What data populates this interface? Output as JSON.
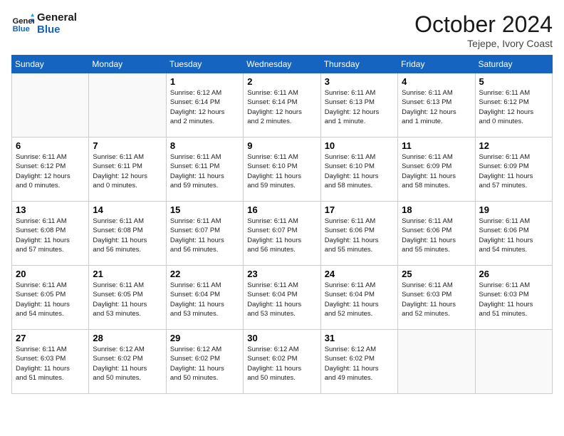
{
  "logo": {
    "line1": "General",
    "line2": "Blue"
  },
  "title": "October 2024",
  "subtitle": "Tejepe, Ivory Coast",
  "days_of_week": [
    "Sunday",
    "Monday",
    "Tuesday",
    "Wednesday",
    "Thursday",
    "Friday",
    "Saturday"
  ],
  "weeks": [
    [
      {
        "day": "",
        "info": ""
      },
      {
        "day": "",
        "info": ""
      },
      {
        "day": "1",
        "info": "Sunrise: 6:12 AM\nSunset: 6:14 PM\nDaylight: 12 hours\nand 2 minutes."
      },
      {
        "day": "2",
        "info": "Sunrise: 6:11 AM\nSunset: 6:14 PM\nDaylight: 12 hours\nand 2 minutes."
      },
      {
        "day": "3",
        "info": "Sunrise: 6:11 AM\nSunset: 6:13 PM\nDaylight: 12 hours\nand 1 minute."
      },
      {
        "day": "4",
        "info": "Sunrise: 6:11 AM\nSunset: 6:13 PM\nDaylight: 12 hours\nand 1 minute."
      },
      {
        "day": "5",
        "info": "Sunrise: 6:11 AM\nSunset: 6:12 PM\nDaylight: 12 hours\nand 0 minutes."
      }
    ],
    [
      {
        "day": "6",
        "info": "Sunrise: 6:11 AM\nSunset: 6:12 PM\nDaylight: 12 hours\nand 0 minutes."
      },
      {
        "day": "7",
        "info": "Sunrise: 6:11 AM\nSunset: 6:11 PM\nDaylight: 12 hours\nand 0 minutes."
      },
      {
        "day": "8",
        "info": "Sunrise: 6:11 AM\nSunset: 6:11 PM\nDaylight: 11 hours\nand 59 minutes."
      },
      {
        "day": "9",
        "info": "Sunrise: 6:11 AM\nSunset: 6:10 PM\nDaylight: 11 hours\nand 59 minutes."
      },
      {
        "day": "10",
        "info": "Sunrise: 6:11 AM\nSunset: 6:10 PM\nDaylight: 11 hours\nand 58 minutes."
      },
      {
        "day": "11",
        "info": "Sunrise: 6:11 AM\nSunset: 6:09 PM\nDaylight: 11 hours\nand 58 minutes."
      },
      {
        "day": "12",
        "info": "Sunrise: 6:11 AM\nSunset: 6:09 PM\nDaylight: 11 hours\nand 57 minutes."
      }
    ],
    [
      {
        "day": "13",
        "info": "Sunrise: 6:11 AM\nSunset: 6:08 PM\nDaylight: 11 hours\nand 57 minutes."
      },
      {
        "day": "14",
        "info": "Sunrise: 6:11 AM\nSunset: 6:08 PM\nDaylight: 11 hours\nand 56 minutes."
      },
      {
        "day": "15",
        "info": "Sunrise: 6:11 AM\nSunset: 6:07 PM\nDaylight: 11 hours\nand 56 minutes."
      },
      {
        "day": "16",
        "info": "Sunrise: 6:11 AM\nSunset: 6:07 PM\nDaylight: 11 hours\nand 56 minutes."
      },
      {
        "day": "17",
        "info": "Sunrise: 6:11 AM\nSunset: 6:06 PM\nDaylight: 11 hours\nand 55 minutes."
      },
      {
        "day": "18",
        "info": "Sunrise: 6:11 AM\nSunset: 6:06 PM\nDaylight: 11 hours\nand 55 minutes."
      },
      {
        "day": "19",
        "info": "Sunrise: 6:11 AM\nSunset: 6:06 PM\nDaylight: 11 hours\nand 54 minutes."
      }
    ],
    [
      {
        "day": "20",
        "info": "Sunrise: 6:11 AM\nSunset: 6:05 PM\nDaylight: 11 hours\nand 54 minutes."
      },
      {
        "day": "21",
        "info": "Sunrise: 6:11 AM\nSunset: 6:05 PM\nDaylight: 11 hours\nand 53 minutes."
      },
      {
        "day": "22",
        "info": "Sunrise: 6:11 AM\nSunset: 6:04 PM\nDaylight: 11 hours\nand 53 minutes."
      },
      {
        "day": "23",
        "info": "Sunrise: 6:11 AM\nSunset: 6:04 PM\nDaylight: 11 hours\nand 53 minutes."
      },
      {
        "day": "24",
        "info": "Sunrise: 6:11 AM\nSunset: 6:04 PM\nDaylight: 11 hours\nand 52 minutes."
      },
      {
        "day": "25",
        "info": "Sunrise: 6:11 AM\nSunset: 6:03 PM\nDaylight: 11 hours\nand 52 minutes."
      },
      {
        "day": "26",
        "info": "Sunrise: 6:11 AM\nSunset: 6:03 PM\nDaylight: 11 hours\nand 51 minutes."
      }
    ],
    [
      {
        "day": "27",
        "info": "Sunrise: 6:11 AM\nSunset: 6:03 PM\nDaylight: 11 hours\nand 51 minutes."
      },
      {
        "day": "28",
        "info": "Sunrise: 6:12 AM\nSunset: 6:02 PM\nDaylight: 11 hours\nand 50 minutes."
      },
      {
        "day": "29",
        "info": "Sunrise: 6:12 AM\nSunset: 6:02 PM\nDaylight: 11 hours\nand 50 minutes."
      },
      {
        "day": "30",
        "info": "Sunrise: 6:12 AM\nSunset: 6:02 PM\nDaylight: 11 hours\nand 50 minutes."
      },
      {
        "day": "31",
        "info": "Sunrise: 6:12 AM\nSunset: 6:02 PM\nDaylight: 11 hours\nand 49 minutes."
      },
      {
        "day": "",
        "info": ""
      },
      {
        "day": "",
        "info": ""
      }
    ]
  ]
}
